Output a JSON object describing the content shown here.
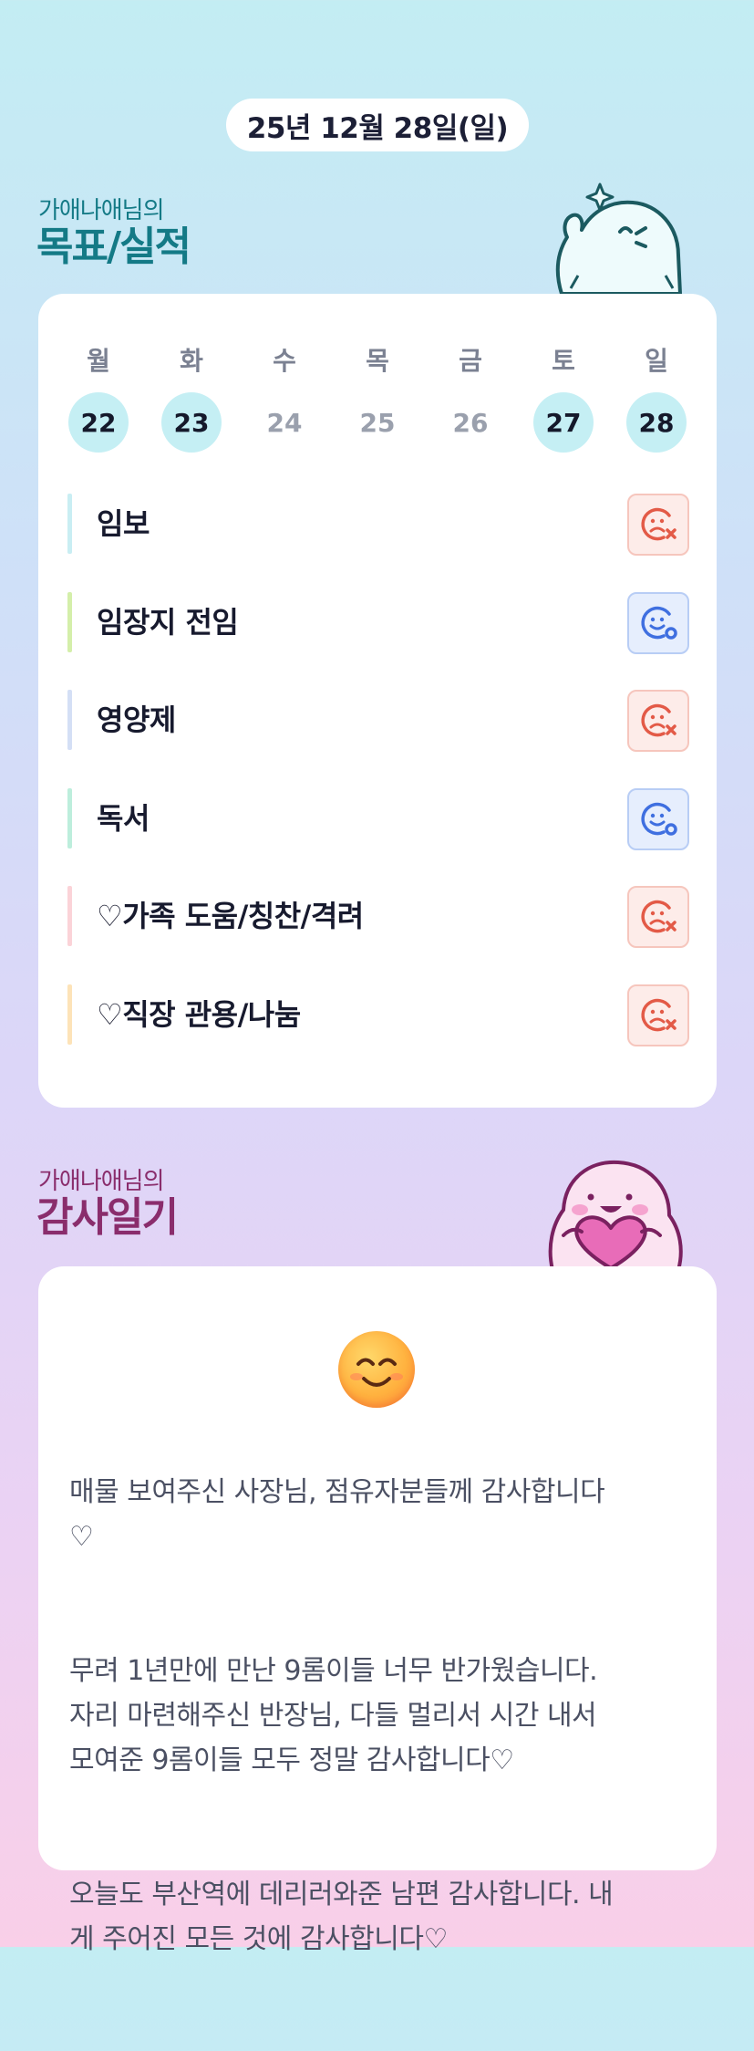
{
  "header": {
    "date": "25년 12월 28일(일)"
  },
  "goals_section": {
    "owner_label": "가애나애님의",
    "title": "목표/실적",
    "character": "waving-ghost-illustration"
  },
  "week": {
    "days": [
      {
        "weekday": "월",
        "date": "22",
        "done": true
      },
      {
        "weekday": "화",
        "date": "23",
        "done": true
      },
      {
        "weekday": "수",
        "date": "24",
        "done": false
      },
      {
        "weekday": "목",
        "date": "25",
        "done": false
      },
      {
        "weekday": "금",
        "date": "26",
        "done": false
      },
      {
        "weekday": "토",
        "date": "27",
        "done": true
      },
      {
        "weekday": "일",
        "date": "28",
        "done": true
      }
    ]
  },
  "goals": [
    {
      "label": "임보",
      "accent": "#c9eef3",
      "status": "fail",
      "icon": "sad-face-x-icon"
    },
    {
      "label": "임장지 전임",
      "accent": "#d4efaa",
      "status": "pass",
      "icon": "happy-face-check-icon"
    },
    {
      "label": "영양제",
      "accent": "#d4dff5",
      "status": "fail",
      "icon": "sad-face-x-icon"
    },
    {
      "label": "독서",
      "accent": "#bdeedc",
      "status": "pass",
      "icon": "happy-face-check-icon"
    },
    {
      "label": "♡가족 도움/칭찬/격려",
      "accent": "#fbd3d8",
      "status": "fail",
      "icon": "sad-face-x-icon"
    },
    {
      "label": "♡직장 관용/나눔",
      "accent": "#fde3b8",
      "status": "fail",
      "icon": "sad-face-x-icon"
    }
  ],
  "gratitude_section": {
    "owner_label": "가애나애님의",
    "title": "감사일기",
    "character": "heart-hugging-ghost-illustration"
  },
  "diary": {
    "mood": "smiling-face-emoji",
    "paragraphs": [
      "매물 보여주신 사장님, 점유자분들께 감사합니다\n♡",
      "무려 1년만에 만난 9롬이들 너무 반가웠습니다.\n자리 마련해주신 반장님, 다들 멀리서 시간 내서\n모여준 9롬이들 모두 정말 감사합니다♡",
      "오늘도 부산역에 데리러와준 남편 감사합니다. 내\n게 주어진 모든 것에 감사합니다♡"
    ]
  },
  "colors": {
    "fail": "#e35a47",
    "pass": "#3f6fe0",
    "goals_title": "#147a86",
    "gratitude_title": "#8a2d6c",
    "active_day": "#c5eff4"
  }
}
